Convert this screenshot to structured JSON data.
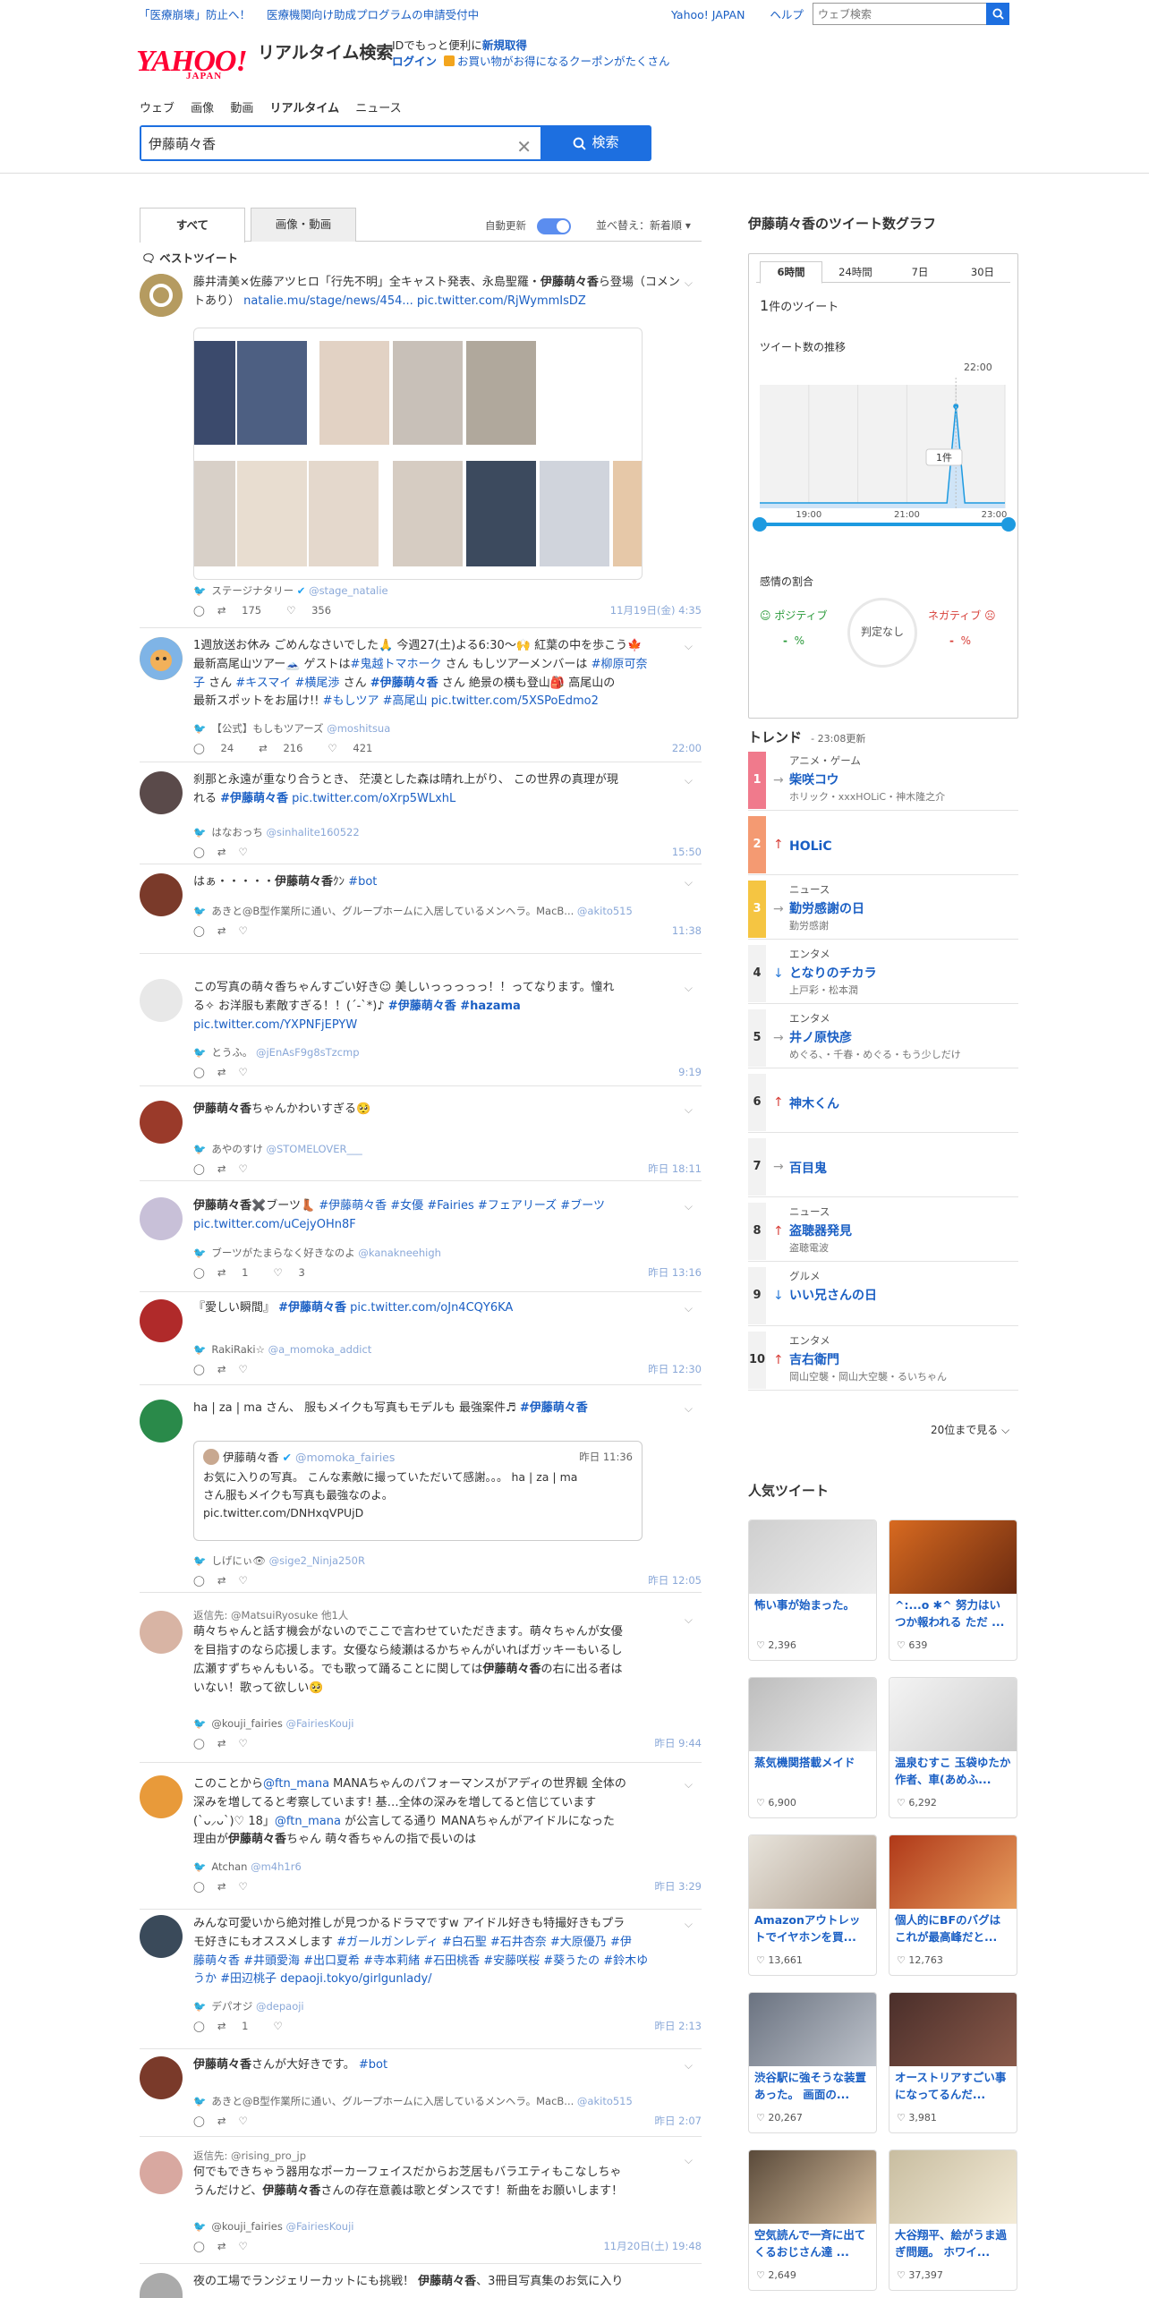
{
  "topbar": {
    "notice1": "「医療崩壊」防止へ！",
    "notice2": "医療機関向け助成プログラムの申請受付中",
    "link_home": "Yahoo! JAPAN",
    "link_help": "ヘルプ",
    "search_placeholder": "ウェブ検索"
  },
  "header": {
    "logo": "YAHOO!",
    "logo_sub": "JAPAN",
    "service": "リアルタイム検索",
    "promo_line1": "IDでもっと便利に",
    "promo_signup": "新規取得",
    "promo_login": "ログイン",
    "promo_coupon": "お買い物がお得になるクーポンがたくさん"
  },
  "nav": [
    "ウェブ",
    "画像",
    "動画",
    "リアルタイム",
    "ニュース"
  ],
  "search": {
    "value": "伊藤萌々香",
    "button": "検索"
  },
  "tabs": {
    "all": "すべて",
    "media": "画像・動画",
    "auto_update": "自動更新",
    "sort": "並べ替え：新着順"
  },
  "best_label": "ベストツイート",
  "tweets": [
    {
      "text_pre": "藤井清美×佐藤アツヒロ「行先不明」全キャスト発表、永島聖羅・",
      "bold": "伊藤萌々香",
      "text_post": "ら登場（コメントあり）",
      "link": "natalie.mu/stage/news/454... pic.twitter.com/RjWymmIsDZ",
      "user": "ステージナタリー",
      "handle": "@stage_natalie",
      "rt": "175",
      "like": "356",
      "time": "11月19日(金) 4:35"
    },
    {
      "line1": "1週放送お休み ごめんなさいでした🙏 今週27(土)よる6:30〜🙌 紅葉の中を歩こう🍁",
      "line2": "最新高尾山ツアー🗻 ゲストは",
      "tag1": "#鬼越トマホーク",
      "line2b": " さん もしツアーメンバーは ",
      "tag2": "#柳原可奈",
      "line3a": "子",
      "line3b": " さん ",
      "tag3": "#キスマイ",
      "tag4": " #横尾渉",
      "line3c": " さん ",
      "tag5": "#伊藤萌々香",
      "line3d": " さん 絶景の横も登山🎒 高尾山の",
      "line4": "最新スポットをお届け!! ",
      "tag6": "#もしツア #高尾山",
      "link": " pic.twitter.com/5XSPoEdmo2",
      "user": "【公式】もしもツアーズ",
      "handle": "@moshitsua",
      "rt": "216",
      "like": "421",
      "reply": "24",
      "time": "22:00"
    },
    {
      "line1": "刹那と永遠が重なり合うとき、 茫漠とした森は晴れ上がり、 この世界の真理が現",
      "line2": "れる ",
      "tag": "#伊藤萌々香",
      "link": " pic.twitter.com/oXrp5WLxhL",
      "user": "はなおっち",
      "handle": "@sinhalite160522",
      "time": "15:50"
    },
    {
      "pre": "はぁ・・・・・",
      "bold": "伊藤萌々香",
      "post": "ｸﾝ ",
      "tag": "#bot",
      "user": "あきと@B型作業所に通い、グループホームに入居しているメンヘラ。MacB...",
      "handle": "@akito515",
      "time": "11:38"
    },
    {
      "line1": "この写真の萌々香ちゃんすごい好き☺︎ 美しいっっっっっ！！ってなります。憧れ",
      "line2a": "る✧ お洋服も素敵すぎる！！(´-`*)♪ ",
      "tag": "#伊藤萌々香 #hazama",
      "link": "pic.twitter.com/YXPNFjEPYW",
      "user": "とうふ。",
      "handle": "@jEnAsF9g8sTzcmp",
      "time": "9:19"
    },
    {
      "bold": "伊藤萌々香",
      "post": "ちゃんかわいすぎる🥺",
      "user": "あやのすけ",
      "handle": "@STOMELOVER___",
      "time": "昨日 18:11"
    },
    {
      "bold": "伊藤萌々香",
      "post": "✖️ブーツ👢 ",
      "tag": "#伊藤萌々香 #女優 #Fairies #フェアリーズ #ブーツ",
      "link": "pic.twitter.com/uCejyOHn8F",
      "user": "ブーツがたまらなく好きなのよ",
      "handle": "@kanakneehigh",
      "rt": "1",
      "like": "3",
      "time": "昨日 13:16"
    },
    {
      "pre": "『愛しい瞬間』 ",
      "tag": "#伊藤萌々香",
      "link": " pic.twitter.com/oJn4CQY6KA",
      "user": "RakiRaki☆",
      "handle": "@a_momoka_addict",
      "time": "昨日 12:30"
    },
    {
      "pre": "ha | za | ma さん、 服もメイクも写真もモデルも 最強案件♬ ",
      "tag": "#伊藤萌々香",
      "quote_user": "伊藤萌々香",
      "quote_handle": "@momoka_fairies",
      "quote_time": "昨日 11:36",
      "quote_text1": "お気に入りの写真。 こんな素敵に撮っていただいて感謝。。。 ha | za | ma",
      "quote_text2": "さん服もメイクも写真も最強なのよ。",
      "quote_link": "pic.twitter.com/DNHxqVPUjD",
      "user": "しげにぃ👁",
      "handle": "@sige2_Ninja250R",
      "time": "昨日 12:05"
    },
    {
      "reply_to": "返信先: @MatsuiRyosuke 他1人",
      "line1": "萌々ちゃんと話す機会がないのでここで言わせていただきます。萌々ちゃんが女優",
      "line2": "を目指すのなら応援します。女優なら綾瀬はるかちゃんがいればガッキーもいるし",
      "line3": "広瀬すずちゃんもいる。でも歌って踊ることに関しては",
      "bold": "伊藤萌々香",
      "line3b": "の右に出る者は",
      "line4": "いない！歌って欲しい🥺",
      "user": "@kouji_fairies",
      "handle": "@FairiesKouji",
      "time": "昨日 9:44"
    },
    {
      "line1a": "このことから",
      "mention": "@ftn_mana",
      "line1b": " MANAちゃんのパフォーマンスがアディの世界観 全体の",
      "line2": "深みを増してると考察しています! 基…全体の深みを増してると信じています",
      "line3a": "(`ᴗ⸝ᴗ`)♡ 18」",
      "mention2": "@ftn_mana",
      "line3b": " が公言してる通り MANAちゃんがアイドルになった",
      "line4a": "理由が",
      "bold": "伊藤萌々香",
      "line4b": "ちゃん 萌々香ちゃんの指で長いのは",
      "user": "Atchan",
      "handle": "@m4h1r6",
      "time": "昨日 3:29"
    },
    {
      "line1": "みんな可愛いから絶対推しが見つかるドラマですw アイドル好きも特撮好きもプラ",
      "line2a": "モ好きにもオススメします ",
      "tags1": "#ガールガンレディ #白石聖 #石井杏奈 #大原優乃 #伊",
      "line3": "藤萌々香 #井頭愛海 #出口夏希 #寺本莉緒 #石田桃香 #安藤咲桜 #葵うたの #鈴木ゆ",
      "line4": "うか #田辺桃子",
      "link": " depaoji.tokyo/girlgunlady/",
      "user": "デパオジ",
      "handle": "@depaoji",
      "rt": "1",
      "time": "昨日 2:13"
    },
    {
      "bold": "伊藤萌々香",
      "post": "さんが大好きです。 ",
      "tag": "#bot",
      "user": "あきと@B型作業所に通い、グループホームに入居しているメンヘラ。MacB...",
      "handle": "@akito515",
      "time": "昨日 2:07"
    },
    {
      "reply_to": "返信先: @rising_pro_jp",
      "line1": "何でもできちゃう器用なポーカーフェイスだからお芝居もバラエティもこなしちゃ",
      "line2a": "うんだけど、",
      "bold": "伊藤萌々香",
      "line2b": "さんの存在意義は歌とダンスです！新曲をお願いします！",
      "user": "@kouji_fairies",
      "handle": "@FairiesKouji",
      "time": "11月20日(土) 19:48"
    },
    {
      "pre": "夜の工場でランジェリーカットにも挑戦！ ",
      "bold": "伊藤萌々香",
      "post": "、3冊目写真集のお気に入り"
    }
  ],
  "graph": {
    "title": "伊藤萌々香のツイート数グラフ",
    "tabs": [
      "6時間",
      "24時間",
      "7日",
      "30日"
    ],
    "count_num": "1",
    "count_unit": "件のツイート",
    "trend_label": "ツイート数の推移",
    "peak_time": "22:00",
    "tooltip": "1件",
    "x_ticks": [
      "19:00",
      "21:00",
      "23:00"
    ],
    "sentiment_label": "感情の割合",
    "positive": "ポジティブ",
    "negative": "ネガティブ",
    "neutral": "判定なし",
    "pos_val": "-",
    "neg_val": "-",
    "pct": "%"
  },
  "chart_data": {
    "type": "area",
    "x": [
      "18:00",
      "19:00",
      "20:00",
      "21:00",
      "22:00",
      "23:00"
    ],
    "values": [
      0,
      0,
      0,
      0,
      1,
      0
    ],
    "title": "ツイート数の推移",
    "xlabel": "",
    "ylabel": "",
    "ylim": [
      0,
      1
    ]
  },
  "trends": {
    "title": "トレンド",
    "updated": "23:08更新",
    "items": [
      {
        "rank": "1",
        "cat": "アニメ・ゲーム",
        "name": "柴咲コウ",
        "sub": "ホリック・xxxHOLiC・神木隆之介",
        "arrow": "→",
        "color": "#f07a8c"
      },
      {
        "rank": "2",
        "cat": "",
        "name": "HOLiC",
        "sub": "",
        "arrow": "↑",
        "color": "#f49a72"
      },
      {
        "rank": "3",
        "cat": "ニュース",
        "name": "勤労感謝の日",
        "sub": "勤労感謝",
        "arrow": "→",
        "color": "#f5c542"
      },
      {
        "rank": "4",
        "cat": "エンタメ",
        "name": "となりのチカラ",
        "sub": "上戸彩・松本潤",
        "arrow": "↓",
        "color": "#f2f2f2"
      },
      {
        "rank": "5",
        "cat": "エンタメ",
        "name": "井ノ原快彦",
        "sub": "めぐる、・千春・めぐる・もう少しだけ",
        "arrow": "→",
        "color": "#f2f2f2"
      },
      {
        "rank": "6",
        "cat": "",
        "name": "神木くん",
        "sub": "",
        "arrow": "↑",
        "color": "#f2f2f2"
      },
      {
        "rank": "7",
        "cat": "",
        "name": "百目鬼",
        "sub": "",
        "arrow": "→",
        "color": "#f2f2f2"
      },
      {
        "rank": "8",
        "cat": "ニュース",
        "name": "盗聴器発見",
        "sub": "盗聴電波",
        "arrow": "↑",
        "color": "#f2f2f2"
      },
      {
        "rank": "9",
        "cat": "グルメ",
        "name": "いい兄さんの日",
        "sub": "",
        "arrow": "↓",
        "color": "#f2f2f2"
      },
      {
        "rank": "10",
        "cat": "エンタメ",
        "name": "吉右衛門",
        "sub": "岡山空襲・岡山大空襲・るいちゃん",
        "arrow": "↑",
        "color": "#f2f2f2"
      }
    ],
    "more": "20位まで見る"
  },
  "popular": {
    "title": "人気ツイート",
    "items": [
      {
        "text": "怖い事が始まった。",
        "likes": "2,396"
      },
      {
        "text": "^:...o ✱^ 努力はいつか報われる ただ ...",
        "likes": "639"
      },
      {
        "text": "蒸気機関搭載メイド",
        "likes": "6,900"
      },
      {
        "text": "温泉むすこ 玉袋ゆたか作者、車(あめふ...",
        "likes": "6,292"
      },
      {
        "text": "Amazonアウトレットでイヤホンを買...",
        "likes": "13,661"
      },
      {
        "text": "個人的にBFのバグはこれが最高峰だと...",
        "likes": "12,763"
      },
      {
        "text": "渋谷駅に強そうな装置あった。 画面の...",
        "likes": "20,267"
      },
      {
        "text": "オーストリアすごい事になってるんだ...",
        "likes": "3,981"
      },
      {
        "text": "空気読んで一斉に出てくるおじさん達 ...",
        "likes": "2,649"
      },
      {
        "text": "大谷翔平、絵がうま過ぎ問題。 ホワイ...",
        "likes": "37,397"
      }
    ]
  }
}
